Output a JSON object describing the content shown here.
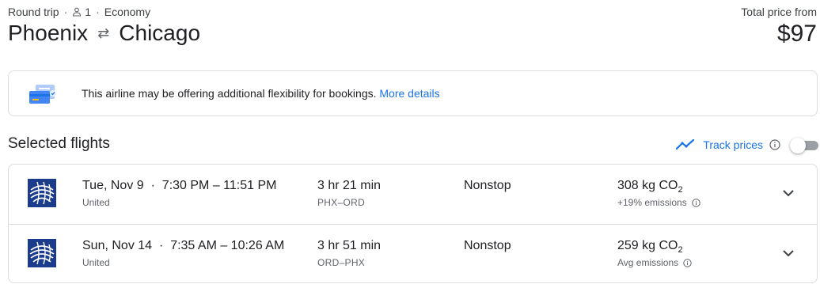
{
  "header": {
    "trip_type": "Round trip",
    "passengers": "1",
    "cabin": "Economy",
    "origin": "Phoenix",
    "destination": "Chicago",
    "price_label": "Total price from",
    "price": "$97"
  },
  "notice": {
    "text": "This airline may be offering additional flexibility for bookings.",
    "link": "More details"
  },
  "selected": {
    "title": "Selected flights",
    "track_label": "Track prices"
  },
  "flights": [
    {
      "date": "Tue, Nov 9",
      "time": "7:30 PM – 11:51 PM",
      "airline": "United",
      "duration": "3 hr 21 min",
      "route": "PHX–ORD",
      "stops": "Nonstop",
      "co2_value": "308 kg CO",
      "co2_sub": "2",
      "emissions": "+19% emissions"
    },
    {
      "date": "Sun, Nov 14",
      "time": "7:35 AM – 10:26 AM",
      "airline": "United",
      "duration": "3 hr 51 min",
      "route": "ORD–PHX",
      "stops": "Nonstop",
      "co2_value": "259 kg CO",
      "co2_sub": "2",
      "emissions": "Avg emissions"
    }
  ],
  "colors": {
    "accent": "#1a73e8",
    "united_blue": "#1b3b8c",
    "border": "#dadce0"
  },
  "icons": {
    "passenger": "person-icon",
    "swap": "swap-arrows-icon",
    "notice": "flexible-booking-illustration",
    "trend": "trending-icon",
    "info": "info-icon",
    "airline": "united-logo",
    "expand": "chevron-down-icon"
  }
}
